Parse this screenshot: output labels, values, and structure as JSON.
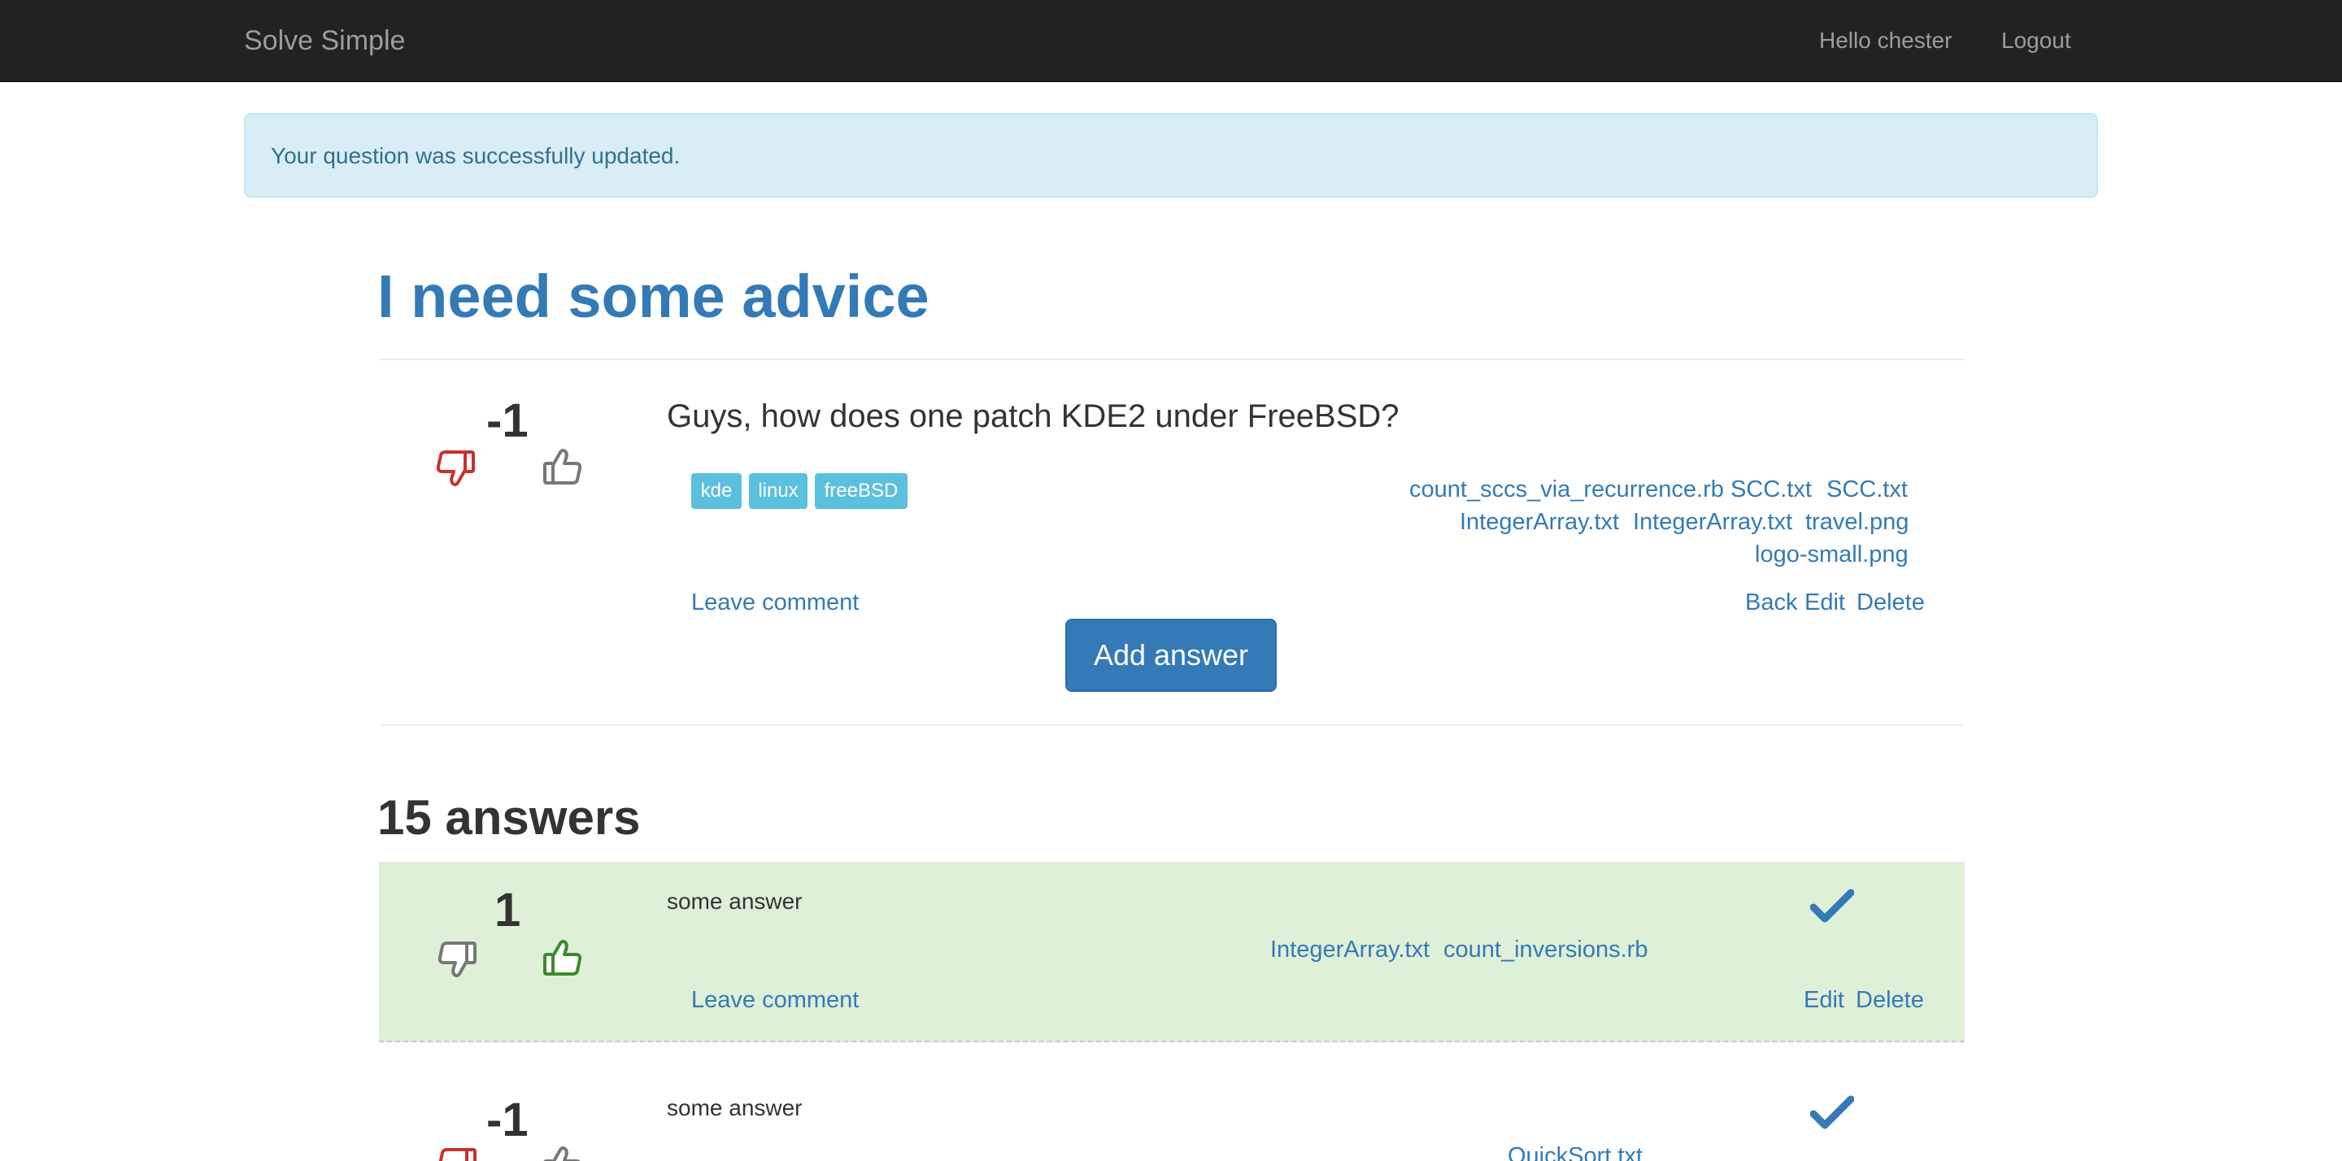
{
  "navbar": {
    "brand": "Solve Simple",
    "greeting": "Hello chester",
    "logout": "Logout"
  },
  "alert": {
    "message": "Your question was successfully updated."
  },
  "question": {
    "title": "I need some advice",
    "score": "-1",
    "body": "Guys, how does one patch KDE2 under FreeBSD?",
    "tags": [
      "kde",
      "linux",
      "freeBSD"
    ],
    "attachments": [
      "count_sccs_via_recurrence.rb",
      "SCC.txt",
      "SCC.txt",
      "IntegerArray.txt",
      "IntegerArray.txt",
      "travel.png",
      "logo-small.png"
    ],
    "leave_comment": "Leave comment",
    "actions": {
      "back": "Back",
      "edit": "Edit",
      "delete": "Delete"
    },
    "add_answer": "Add answer",
    "downvote_state": "active",
    "upvote_state": "inactive"
  },
  "answers_heading": "15 answers",
  "answers": [
    {
      "score": "1",
      "body": "some answer",
      "accepted": true,
      "attachments": [
        "IntegerArray.txt",
        "count_inversions.rb"
      ],
      "leave_comment": "Leave comment",
      "actions": {
        "edit": "Edit",
        "delete": "Delete"
      },
      "upvote_state": "active",
      "downvote_state": "inactive"
    },
    {
      "score": "-1",
      "body": "some answer",
      "accepted": false,
      "attachments": [
        "QuickSort.txt"
      ],
      "downvote_state": "active",
      "upvote_state": "inactive"
    }
  ],
  "colors": {
    "navbar_bg": "#222222",
    "link": "#337ab7",
    "alert_bg": "#d9edf7",
    "alert_text": "#31708f",
    "tag_bg": "#5bc0de",
    "accepted_bg": "#dff0d8",
    "downvote_active": "#c9302c",
    "upvote_active": "#3c8a2e",
    "vote_inactive": "#777777"
  }
}
